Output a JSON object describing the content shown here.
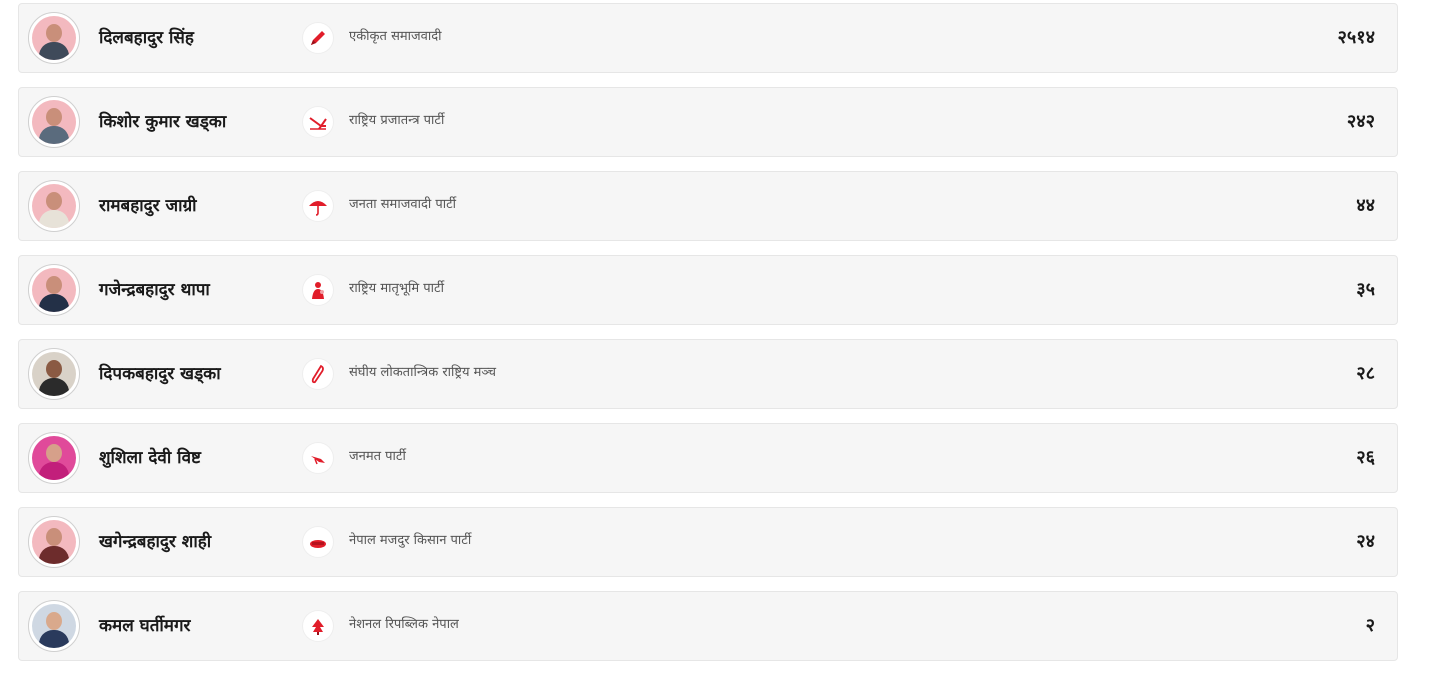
{
  "candidates": [
    {
      "name": "दिलबहादुर सिंह",
      "party": "एकीकृत समाजवादी",
      "votes": "२५१४",
      "party_icon": "pen-icon",
      "icon_color": "#e11d2a"
    },
    {
      "name": "किशोर कुमार खड्का",
      "party": "राष्ट्रिय प्रजातन्त्र पार्टी",
      "votes": "२४२",
      "party_icon": "plough-icon",
      "icon_color": "#e11d2a"
    },
    {
      "name": "रामबहादुर जाग्री",
      "party": "जनता समाजवादी पार्टी",
      "votes": "४४",
      "party_icon": "umbrella-icon",
      "icon_color": "#e11d2a"
    },
    {
      "name": "गजेन्द्रबहादुर थापा",
      "party": "राष्ट्रिय मातृभूमि पार्टी",
      "votes": "३५",
      "party_icon": "mother-child-icon",
      "icon_color": "#e11d2a"
    },
    {
      "name": "दिपकबहादुर खड्का",
      "party": "संघीय लोकतान्त्रिक राष्ट्रिय मञ्च",
      "votes": "२८",
      "party_icon": "horn-icon",
      "icon_color": "#e11d2a"
    },
    {
      "name": "शुशिला देवी विष्ट",
      "party": "जनमत पार्टी",
      "votes": "२६",
      "party_icon": "megaphone-icon",
      "icon_color": "#e11d2a"
    },
    {
      "name": "खगेन्द्रबहादुर शाही",
      "party": "नेपाल मजदुर किसान पार्टी",
      "votes": "२४",
      "party_icon": "madal-drum-icon",
      "icon_color": "#e11d2a"
    },
    {
      "name": "कमल घर्तीमगर",
      "party": "नेशनल रिपब्लिक नेपाल",
      "votes": "२",
      "party_icon": "tree-icon",
      "icon_color": "#e11d2a"
    }
  ],
  "colors": {
    "accent": "#e11d2a",
    "row_bg": "#f6f6f6",
    "text": "#1a1a1a",
    "muted": "#555555"
  }
}
